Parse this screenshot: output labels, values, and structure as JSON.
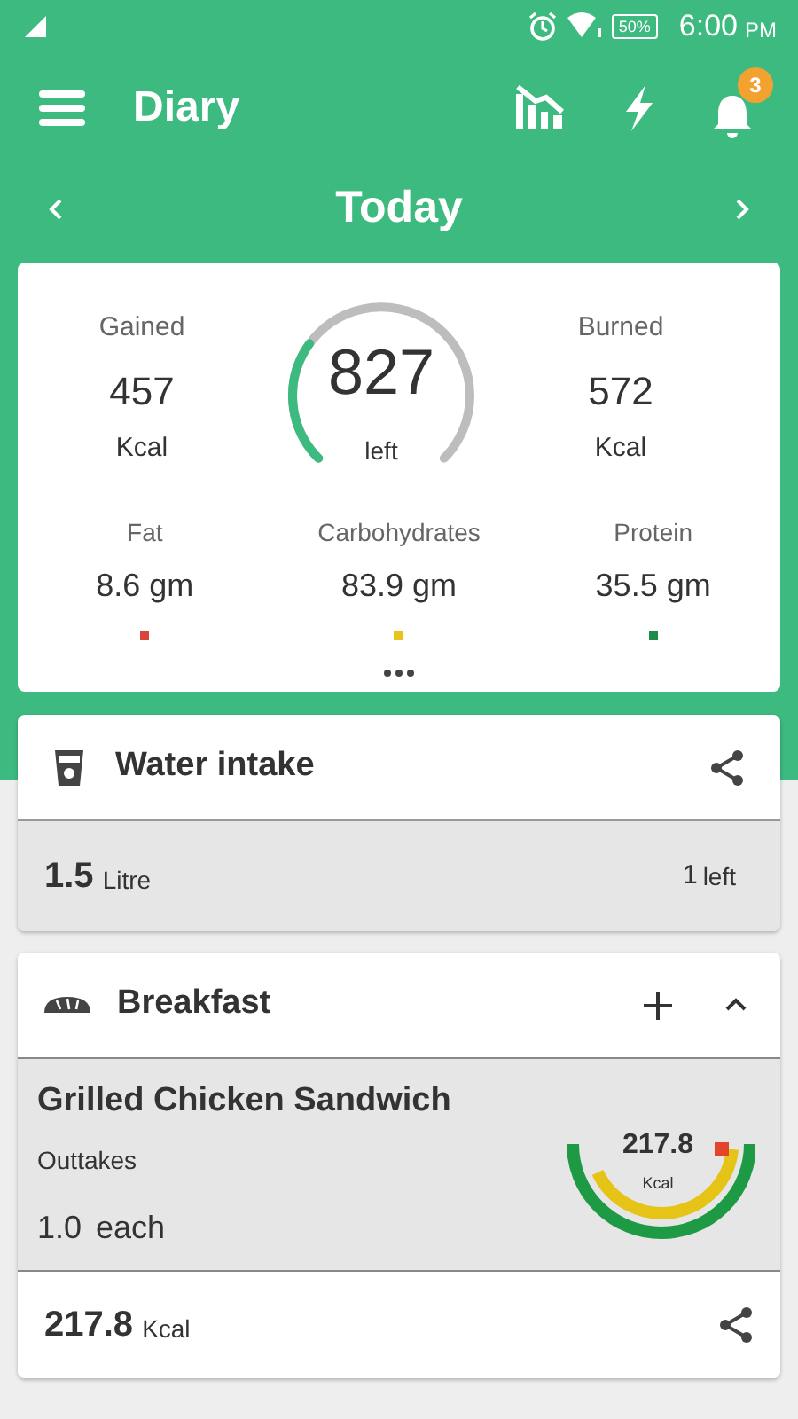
{
  "status_bar": {
    "battery": "50%",
    "time": "6:00",
    "time_suffix": "PM"
  },
  "toolbar": {
    "title": "Diary",
    "notification_badge": "3"
  },
  "date_nav": {
    "label": "Today"
  },
  "summary": {
    "gained": {
      "label": "Gained",
      "value": "457",
      "unit": "Kcal"
    },
    "remaining": {
      "value": "827",
      "label": "left"
    },
    "burned": {
      "label": "Burned",
      "value": "572",
      "unit": "Kcal"
    },
    "macros": [
      {
        "label": "Fat",
        "value": "8.6 gm",
        "color": "#d9443b"
      },
      {
        "label": "Carbohydrates",
        "value": "83.9 gm",
        "color": "#e8c31a"
      },
      {
        "label": "Protein",
        "value": "35.5 gm",
        "color": "#1f8a4c"
      }
    ]
  },
  "water": {
    "title": "Water intake",
    "amount": "1.5",
    "unit": "Litre",
    "remaining": "1",
    "remaining_label": "left"
  },
  "meals": [
    {
      "title": "Breakfast",
      "expanded": true,
      "items": [
        {
          "name": "Grilled Chicken Sandwich",
          "category": "Outtakes",
          "quantity": "1.0",
          "quantity_unit": "each",
          "kcal": "217.8",
          "kcal_unit": "Kcal"
        }
      ],
      "total": "217.8",
      "total_unit": "Kcal"
    }
  ]
}
